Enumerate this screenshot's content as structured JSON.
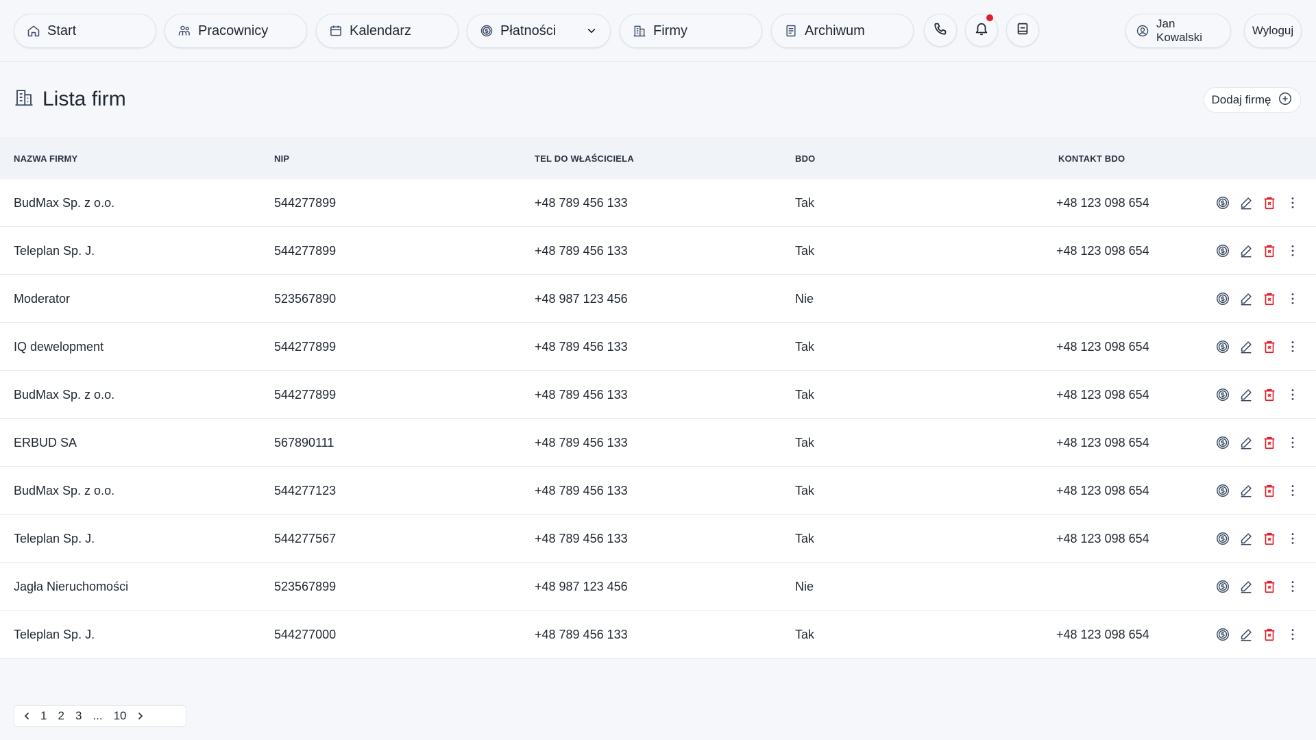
{
  "nav": {
    "items": [
      {
        "label": "Start",
        "icon": "home-icon"
      },
      {
        "label": "Pracownicy",
        "icon": "users-icon"
      },
      {
        "label": "Kalendarz",
        "icon": "calendar-icon"
      },
      {
        "label": "Płatności",
        "icon": "dollar-circle-icon",
        "has_dropdown": true
      },
      {
        "label": "Firmy",
        "icon": "building-icon"
      },
      {
        "label": "Archiwum",
        "icon": "archive-icon"
      }
    ],
    "icon_buttons": [
      "phone-icon",
      "bell-icon",
      "notes-icon"
    ],
    "notification_dot_color": "#e11d2a",
    "user_name": "Jan Kowalski",
    "logout_label": "Wyloguj"
  },
  "page": {
    "title": "Lista firm",
    "add_button_label": "Dodaj firmę"
  },
  "table": {
    "headers": [
      "NAZWA FIRMY",
      "NIP",
      "TEL DO WŁAŚCICIELA",
      "BDO",
      "KONTAKT BDO"
    ],
    "rows": [
      [
        "BudMax Sp. z o.o.",
        "544277899",
        "+48 789 456 133",
        "Tak",
        "+48 123 098 654"
      ],
      [
        "Teleplan Sp. J.",
        "544277899",
        "+48 789 456 133",
        "Tak",
        "+48 123 098 654"
      ],
      [
        "Moderator",
        "523567890",
        "+48 987 123 456",
        "Nie",
        ""
      ],
      [
        "IQ dewelopment",
        "544277899",
        "+48 789 456 133",
        "Tak",
        "+48 123 098 654"
      ],
      [
        "BudMax Sp. z o.o.",
        "544277899",
        "+48 789 456 133",
        "Tak",
        "+48 123 098 654"
      ],
      [
        "ERBUD SA",
        "567890111",
        "+48 789 456 133",
        "Tak",
        "+48 123 098 654"
      ],
      [
        "BudMax Sp. z o.o.",
        "544277123",
        "+48 789 456 133",
        "Tak",
        "+48 123 098 654"
      ],
      [
        "Teleplan Sp. J.",
        "544277567",
        "+48 789 456 133",
        "Tak",
        "+48 123 098 654"
      ],
      [
        "Jagła Nieruchomości",
        "523567899",
        "+48 987 123 456",
        "Nie",
        ""
      ],
      [
        "Teleplan Sp. J.",
        "544277000",
        "+48 789 456 133",
        "Tak",
        "+48 123 098 654"
      ]
    ],
    "row_actions": [
      "payment-icon",
      "edit-icon",
      "delete-icon",
      "more-icon"
    ],
    "delete_color": "#e11d2a",
    "action_color": "#3b4a63"
  },
  "pagination": {
    "pages": [
      "1",
      "2",
      "3",
      "...",
      "10"
    ]
  }
}
